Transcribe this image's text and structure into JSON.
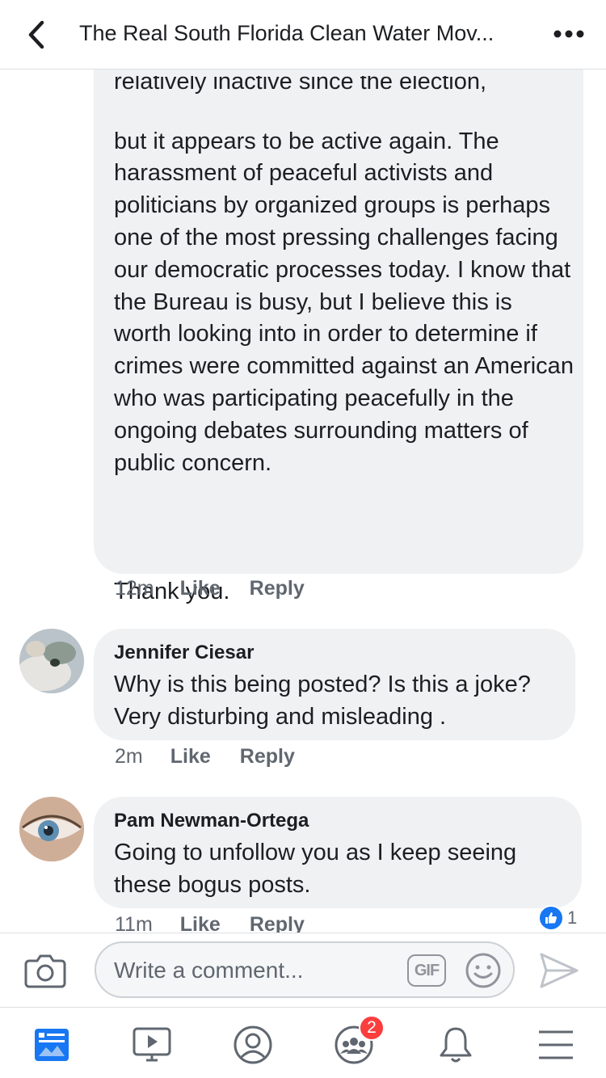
{
  "header": {
    "title": "The Real South Florida Clean Water Mov...",
    "back_icon": "chevron-left-icon",
    "more_icon": "more-dots-icon"
  },
  "main_comment": {
    "cutoff_line": "relatively inactive since the election,",
    "text": "but it appears to be active again. The harassment of peaceful activists and politicians by organized groups is perhaps one of the most pressing challenges facing our democratic processes today. I know that the Bureau is busy, but I believe this is worth looking into in order to determine if crimes were committed against an American who was participating peacefully in the ongoing debates surrounding matters of public concern.",
    "closing": "Thank you.",
    "time": "12m",
    "like": "Like",
    "reply": "Reply"
  },
  "comments": [
    {
      "author": "Jennifer Ciesar",
      "text": "Why is this being posted? Is this a joke? Very disturbing and misleading .",
      "time": "2m",
      "like": "Like",
      "reply": "Reply"
    },
    {
      "author": "Pam Newman-Ortega",
      "text": "Going to unfollow you as I keep seeing these bogus posts.",
      "time": "11m",
      "like": "Like",
      "reply": "Reply",
      "reaction_count": "1"
    }
  ],
  "composer": {
    "placeholder": "Write a comment...",
    "gif_label": "GIF"
  },
  "tabbar": {
    "items": [
      "news-feed",
      "watch",
      "profile",
      "groups",
      "notifications",
      "menu"
    ],
    "groups_badge": "2"
  },
  "colors": {
    "accent": "#1877f2",
    "bubble": "#f0f1f3",
    "badge": "#fa3e3e",
    "muted": "#606770"
  }
}
